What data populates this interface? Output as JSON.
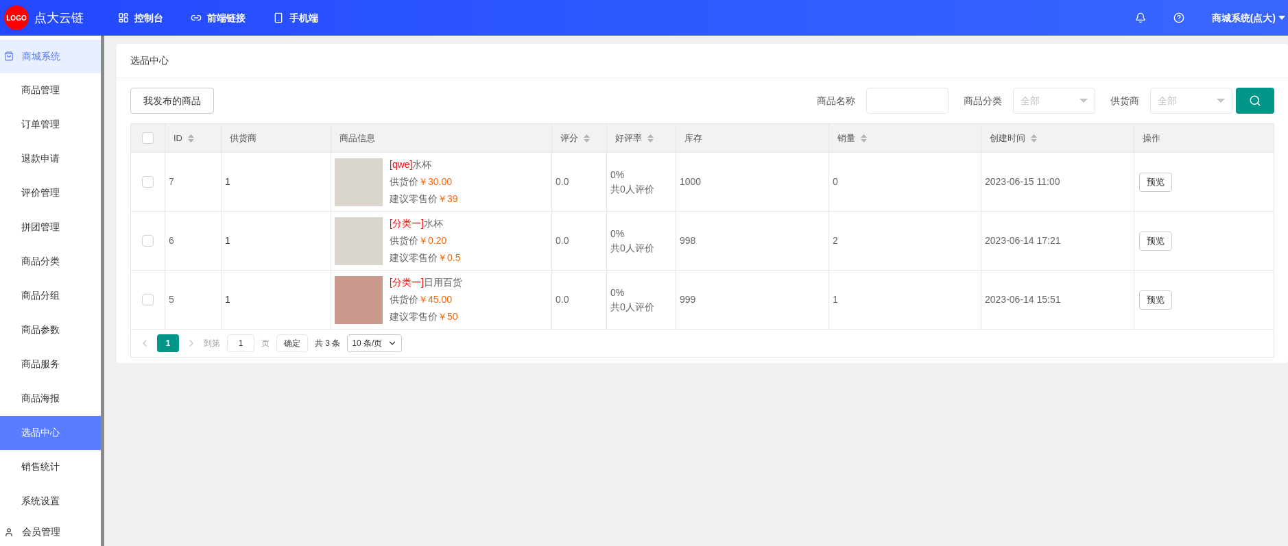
{
  "header": {
    "logo": "LOGO",
    "brand": "点大云链",
    "nav": [
      {
        "kind": "dashboard",
        "label": "控制台"
      },
      {
        "kind": "link",
        "label": "前端链接"
      },
      {
        "kind": "phone",
        "label": "手机端"
      }
    ],
    "user": "商城系统(点大)"
  },
  "sidebar": {
    "group": {
      "label": "商城系统"
    },
    "items": [
      {
        "label": "商品管理",
        "selected": false
      },
      {
        "label": "订单管理",
        "selected": false
      },
      {
        "label": "退款申请",
        "selected": false
      },
      {
        "label": "评价管理",
        "selected": false
      },
      {
        "label": "拼团管理",
        "selected": false
      },
      {
        "label": "商品分类",
        "selected": false
      },
      {
        "label": "商品分组",
        "selected": false
      },
      {
        "label": "商品参数",
        "selected": false
      },
      {
        "label": "商品服务",
        "selected": false
      },
      {
        "label": "商品海报",
        "selected": false
      },
      {
        "label": "选品中心",
        "selected": true
      },
      {
        "label": "销售统计",
        "selected": false
      },
      {
        "label": "系统设置",
        "selected": false
      }
    ],
    "next_group": "会员管理"
  },
  "page": {
    "title": "选品中心",
    "my_button": "我发布的商品",
    "filters": [
      {
        "kind": "input",
        "label": "商品名称"
      },
      {
        "kind": "select",
        "label": "商品分类",
        "placeholder": "全部"
      },
      {
        "kind": "select",
        "label": "供货商",
        "placeholder": "全部"
      }
    ],
    "table": {
      "all_checked": false,
      "columns": [
        {
          "label": "ID",
          "sortable": true
        },
        {
          "label": "供货商",
          "sortable": false
        },
        {
          "label": "商品信息",
          "sortable": false
        },
        {
          "label": "评分",
          "sortable": true
        },
        {
          "label": "好评率",
          "sortable": true
        },
        {
          "label": "库存",
          "sortable": false
        },
        {
          "label": "销量",
          "sortable": true
        },
        {
          "label": "创建时间",
          "sortable": true
        },
        {
          "label": "操作",
          "sortable": false
        }
      ],
      "rows": [
        {
          "checked": false,
          "id": "7",
          "supplier": "1",
          "tag": "[qwe]",
          "name": "水杯",
          "supply_label": "供货价",
          "supply_price": "￥30.00",
          "retail_label": "建议零售价",
          "retail_price": "￥39",
          "score": "0.0",
          "rate": "0%",
          "rate_count": "共0人评价",
          "stock": "1000",
          "sales": "0",
          "created": "2023-06-15 11:00",
          "action": "预览"
        },
        {
          "checked": false,
          "id": "6",
          "supplier": "1",
          "tag": "[分类一]",
          "name": "水杯",
          "supply_label": "供货价",
          "supply_price": "￥0.20",
          "retail_label": "建议零售价",
          "retail_price": "￥0.5",
          "score": "0.0",
          "rate": "0%",
          "rate_count": "共0人评价",
          "stock": "998",
          "sales": "2",
          "created": "2023-06-14 17:21",
          "action": "预览"
        },
        {
          "checked": false,
          "id": "5",
          "supplier": "1",
          "tag": "[分类一]",
          "name": "日用百货",
          "supply_label": "供货价",
          "supply_price": "￥45.00",
          "retail_label": "建议零售价",
          "retail_price": "￥50",
          "score": "0.0",
          "rate": "0%",
          "rate_count": "共0人评价",
          "stock": "999",
          "sales": "1",
          "created": "2023-06-14 15:51",
          "action": "预览"
        }
      ]
    },
    "pagination": {
      "pages": [
        {
          "label": "1",
          "selected": true
        }
      ],
      "goto_label": "到第",
      "goto_value": "1",
      "page_unit": "页",
      "confirm": "确定",
      "total": "共 3 条",
      "page_size": "10 条/页"
    }
  }
}
